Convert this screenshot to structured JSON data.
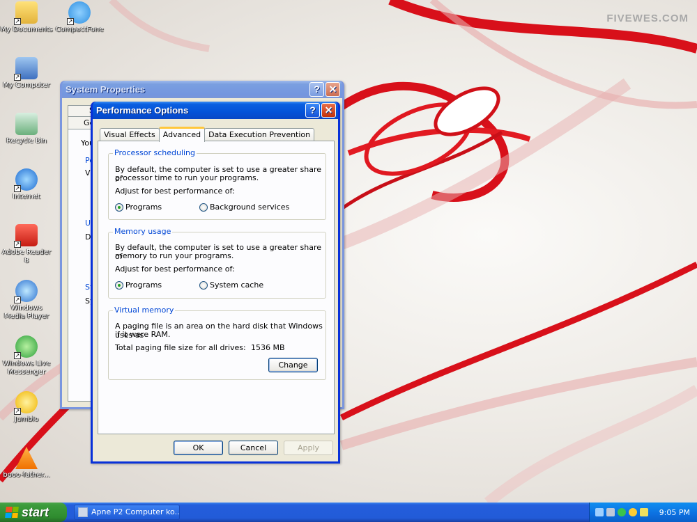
{
  "watermark": "FIVEWES.COM",
  "desktop_icons": [
    {
      "label": "My Documents",
      "icon": "my-documents-icon"
    },
    {
      "label": "CompactFone",
      "icon": "compactfone-icon"
    },
    {
      "label": "My Computer",
      "icon": "my-computer-icon"
    },
    {
      "label": "Recycle Bin",
      "icon": "recycle-bin-icon"
    },
    {
      "label": "Internet",
      "icon": "internet-explorer-icon"
    },
    {
      "label": "Adobe Reader 8",
      "icon": "adobe-reader-icon"
    },
    {
      "label": "Windows Media Player",
      "icon": "media-player-icon"
    },
    {
      "label": "Windows Live Messenger",
      "icon": "messenger-icon"
    },
    {
      "label": "Jumblo",
      "icon": "jumblo-icon"
    },
    {
      "label": "booo-father...",
      "icon": "vlc-icon"
    }
  ],
  "system_properties": {
    "title": "System Properties",
    "help": "?",
    "close": "✕",
    "tab_top": "S",
    "tab_general": "Ge",
    "intro_fragment": "You",
    "group1_fragment": "Pe",
    "group1_text_fragment": "Vi",
    "group2_fragment": "Us",
    "group2_text_fragment": "De",
    "group3_fragment": "St",
    "group3_text_fragment": "Sy"
  },
  "performance_options": {
    "title": "Performance Options",
    "help": "?",
    "close": "✕",
    "tabs": [
      "Visual Effects",
      "Advanced",
      "Data Execution Prevention"
    ],
    "active_tab": "Advanced",
    "processor": {
      "title": "Processor scheduling",
      "desc1": "By default, the computer is set to use a greater share of",
      "desc2": "processor time to run your programs.",
      "adjust": "Adjust for best performance of:",
      "opt1": "Programs",
      "opt2": "Background services",
      "selected": "Programs"
    },
    "memory": {
      "title": "Memory usage",
      "desc1": "By default, the computer is set to use a greater share of",
      "desc2": "memory to run your programs.",
      "adjust": "Adjust for best performance of:",
      "opt1": "Programs",
      "opt2": "System cache",
      "selected": "Programs"
    },
    "virtual": {
      "title": "Virtual memory",
      "desc1": "A paging file is an area on the hard disk that Windows uses as",
      "desc2": "if it were RAM.",
      "total_label": "Total paging file size for all drives:",
      "total_value": "1536 MB",
      "change": "Change"
    },
    "buttons": {
      "ok": "OK",
      "cancel": "Cancel",
      "apply": "Apply"
    }
  },
  "taskbar": {
    "start": "start",
    "task": "Apne P2 Computer ko...",
    "clock": "9:05 PM"
  }
}
